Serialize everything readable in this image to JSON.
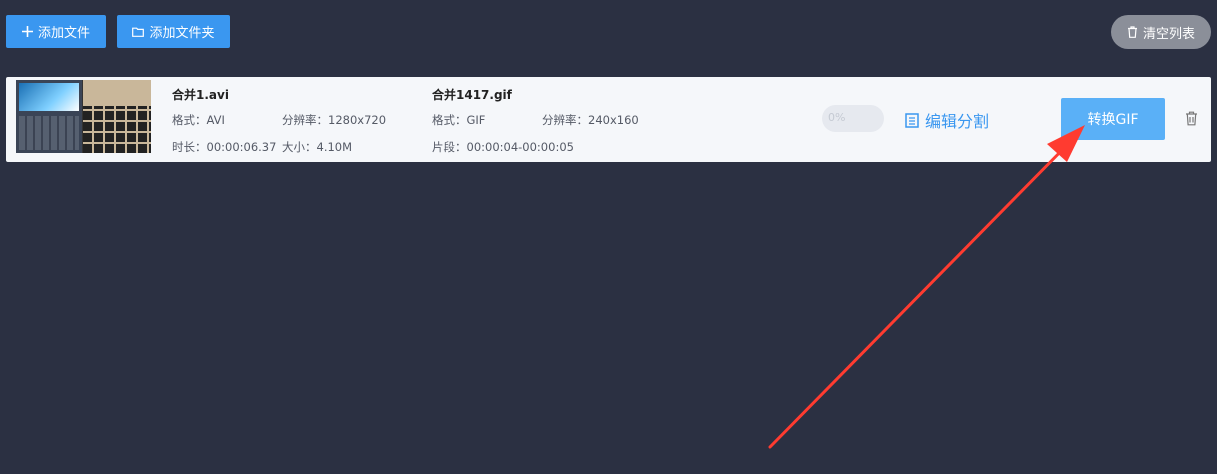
{
  "toolbar": {
    "add_file": "添加文件",
    "add_folder": "添加文件夹",
    "clear_list": "清空列表"
  },
  "file": {
    "source": {
      "name": "合并1.avi",
      "format": "格式：AVI",
      "resolution": "分辨率：1280x720",
      "duration": "时长：00:00:06.37",
      "size": "大小：4.10M"
    },
    "output": {
      "name": "合并1417.gif",
      "format": "格式：GIF",
      "resolution": "分辨率：240x160",
      "segment": "片段：00:00:04-00:00:05"
    },
    "progress_text": "0%",
    "progress": 0,
    "edit_label": "编辑分割",
    "convert_label": "转换GIF"
  },
  "colors": {
    "background": "#2b3042",
    "accent": "#3a97f0",
    "annotation": "#ff3b30"
  }
}
